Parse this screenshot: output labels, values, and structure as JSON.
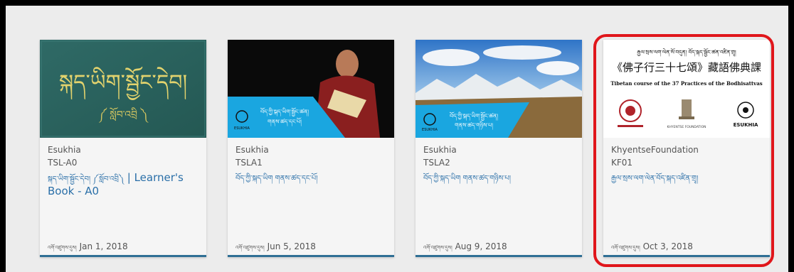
{
  "cards": [
    {
      "org": "Esukhia",
      "code": "TSL-A0",
      "thumb_text": "སྐད་ཡིག་སྦྱོང་དེབ།",
      "thumb_sub": "༼ སློབ་འབྲི ༽",
      "title_tibetan": "སྐད་ཡིག་སྦྱོང་དེབ། ༼སློབ་འབྲི༽",
      "title_latin": " | Learner's Book - A0",
      "date_prefix": "འགོ་འཛུགས་དུས།",
      "date": "Jan 1, 2018"
    },
    {
      "org": "Esukhia",
      "code": "TSLA1",
      "banner_line1": "བོད་ཀྱི་སྐད་ཡིག་སྦྱོང་ཚན།",
      "banner_line2": "གནས་ཚད་དང་པོ།",
      "logo_text": "ESUKHIA",
      "title_tibetan": "བོད་ཀྱི་སྐད་ཡིག གནས་ཚད་དང་པོ།",
      "date_prefix": "འགོ་འཛུགས་དུས།",
      "date": "Jun 5, 2018"
    },
    {
      "org": "Esukhia",
      "code": "TSLA2",
      "banner_line1": "བོད་ཀྱི་སྐད་ཡིག་སྦྱོང་ཚན།",
      "banner_line2": "གནས་ཚད་གཉིས་པ།",
      "logo_text": "ESUKHIA",
      "title_tibetan": "བོད་ཀྱི་སྐད་ཡིག གནས་ཚད་གཉིས་པ།",
      "date_prefix": "འགོ་འཛུགས་དུས།",
      "date": "Aug 9, 2018"
    },
    {
      "org": "KhyentseFoundation",
      "code": "KF01",
      "thumb_line1": "རྒྱལ་སྲས་ལག་ལེན་སོ་བདུན། བོད་སྐད་སྦྱོང་ཚན་འཛིན་གྲྭ།",
      "thumb_line2": "《佛子行三十七頌》藏語佛典課",
      "thumb_line3": "Tibetan course of the 37 Practices of the Bodhisattvas",
      "thumb_logo2": "KHYENTSE FOUNDATION",
      "thumb_logo3": "ESUKHIA",
      "title_tibetan": "རྒྱལ་སྲས་ལག་ལེན་བོད་སྐད་འཛིན་གྲྭ།",
      "date_prefix": "འགོ་འཛུགས་དུས།",
      "date": "Oct 3, 2018"
    }
  ],
  "colors": {
    "accent_link": "#2a6fa8",
    "card_bottom_border": "#2f6f95",
    "highlight_border": "#e0161b",
    "banner_blue": "#1aa6e0"
  }
}
